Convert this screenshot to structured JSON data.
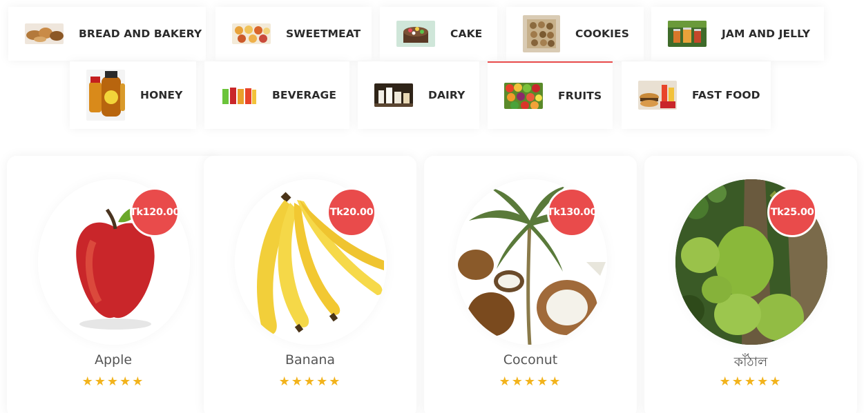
{
  "categories": {
    "active_color": "#e94b4b",
    "active_tab": "FRUITS",
    "items": [
      {
        "label": "BREAD AND BAKERY",
        "icon": "bread-bakery-thumbnail"
      },
      {
        "label": "SWEETMEAT",
        "icon": "sweetmeat-thumbnail"
      },
      {
        "label": "CAKE",
        "icon": "cake-thumbnail"
      },
      {
        "label": "COOKIES",
        "icon": "cookies-thumbnail"
      },
      {
        "label": "JAM AND JELLY",
        "icon": "jam-jelly-thumbnail"
      },
      {
        "label": "HONEY",
        "icon": "honey-thumbnail"
      },
      {
        "label": "BEVERAGE",
        "icon": "beverage-thumbnail"
      },
      {
        "label": "DAIRY",
        "icon": "dairy-thumbnail"
      },
      {
        "label": "FRUITS",
        "icon": "fruits-thumbnail"
      },
      {
        "label": "FAST FOOD",
        "icon": "fast-food-thumbnail"
      }
    ]
  },
  "products": [
    {
      "name": "Apple",
      "price": "Tk120.00",
      "rating": 5,
      "image": "apple-image"
    },
    {
      "name": "Banana",
      "price": "Tk20.00",
      "rating": 5,
      "image": "banana-image"
    },
    {
      "name": "Coconut",
      "price": "Tk130.00",
      "rating": 5,
      "image": "coconut-image"
    },
    {
      "name": "কাঁঠাল",
      "price": "Tk25.00",
      "rating": 5,
      "image": "jackfruit-image"
    }
  ],
  "colors": {
    "badge": "#e94b4b",
    "star": "#f2b31c",
    "label": "#2b2b2b",
    "product_name": "#555555"
  }
}
